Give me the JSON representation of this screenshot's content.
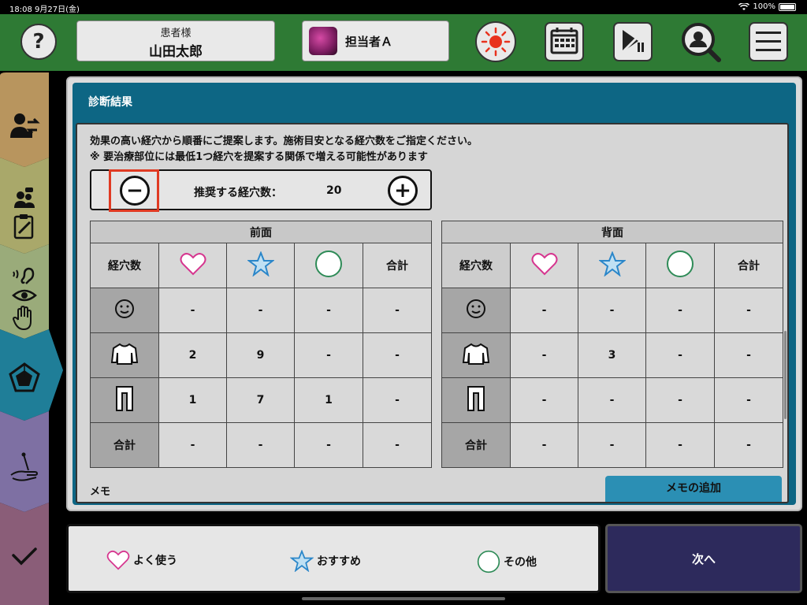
{
  "status": {
    "time": "18:08",
    "date": "9月27日(金)",
    "battery": "100%"
  },
  "header": {
    "help_label": "?",
    "patient_label": "患者様",
    "patient_name": "山田太郎",
    "staff_name": "担当者Ａ"
  },
  "panel": {
    "title": "診断結果",
    "instruction1": "効果の高い経穴から順番にご提案します。施術目安となる経穴数をご指定ください。",
    "instruction2": "※ 要治療部位には最低1つ経穴を提案する関係で増える可能性があります",
    "stepper": {
      "minus": "−",
      "plus": "+",
      "label": "推奨する経穴数：",
      "value": "20"
    },
    "front": {
      "title": "前面",
      "col_first": "経穴数",
      "col_total": "合計",
      "rows": [
        {
          "c1": "-",
          "c2": "-",
          "c3": "-",
          "c4": "-"
        },
        {
          "c1": "2",
          "c2": "9",
          "c3": "-",
          "c4": "-"
        },
        {
          "c1": "1",
          "c2": "7",
          "c3": "1",
          "c4": "-"
        },
        {
          "label": "合計",
          "c1": "-",
          "c2": "-",
          "c3": "-",
          "c4": "-"
        }
      ]
    },
    "back": {
      "title": "背面",
      "col_first": "経穴数",
      "col_total": "合計",
      "rows": [
        {
          "c1": "-",
          "c2": "-",
          "c3": "-",
          "c4": "-"
        },
        {
          "c1": "-",
          "c2": "3",
          "c3": "-",
          "c4": "-"
        },
        {
          "c1": "-",
          "c2": "-",
          "c3": "-",
          "c4": "-"
        },
        {
          "label": "合計",
          "c1": "-",
          "c2": "-",
          "c3": "-",
          "c4": "-"
        }
      ]
    },
    "memo_label": "メモ",
    "memo_add": "メモの追加"
  },
  "legend": {
    "frequent": "よく使う",
    "recommended": "おすすめ",
    "other": "その他"
  },
  "next_label": "次へ",
  "colors": {
    "header": "#2e7a34",
    "panel": "#0d6684",
    "heart": "#d6368f",
    "star": "#2a86c9",
    "circle": "#2e8b57",
    "next": "#2d2a5c"
  }
}
